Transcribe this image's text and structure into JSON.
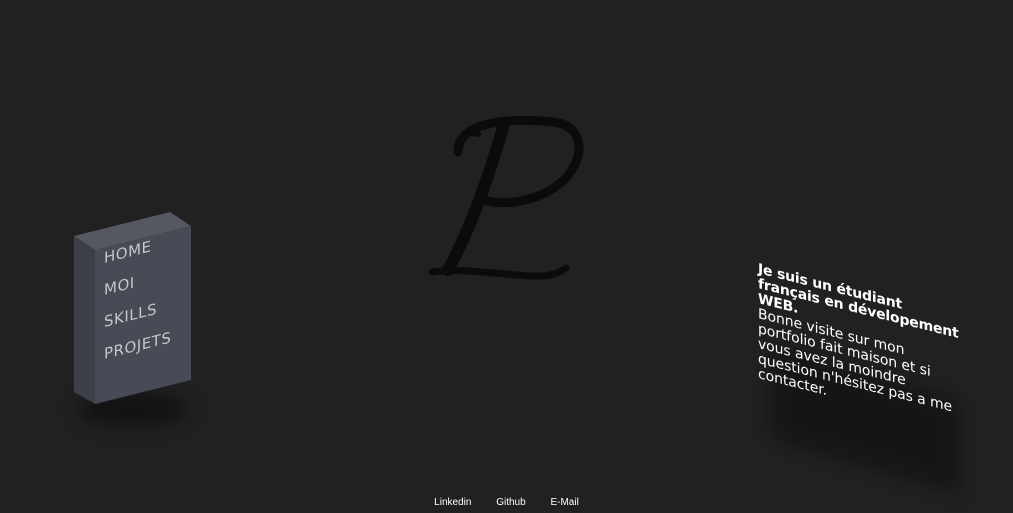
{
  "logo": {
    "letter": "P",
    "icon": "script-p-logo-icon",
    "color": "#0b0b0b"
  },
  "nav": {
    "items": [
      {
        "label": "HOME"
      },
      {
        "label": "MOI"
      },
      {
        "label": "SKILLS"
      },
      {
        "label": "PROJETS"
      }
    ],
    "face_color": "#484b55",
    "side_color": "#3c3f47",
    "top_color": "#555861"
  },
  "intro": {
    "heading": "Je suis un étudiant français en dévelopement WEB.",
    "body": "Bonne visite sur mon portfolio fait maison et si vous avez la moindre question n'hésitez pas a me contacter."
  },
  "footer": {
    "links": [
      {
        "label": "Linkedin"
      },
      {
        "label": "Github"
      },
      {
        "label": "E-Mail"
      }
    ]
  },
  "colors": {
    "background": "#212121",
    "text": "#ffffff"
  }
}
